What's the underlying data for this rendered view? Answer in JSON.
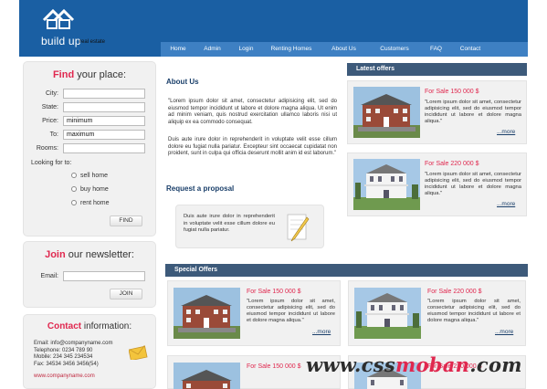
{
  "header": {
    "logo_text": "build up",
    "logo_sub": "real estate",
    "nav": [
      "Home",
      "Admin",
      "Login",
      "Renting Homes",
      "About Us",
      "Customers",
      "FAQ",
      "Contact"
    ]
  },
  "find": {
    "title_accent": "Find",
    "title_rest": " your place:",
    "fields": [
      {
        "label": "City:",
        "value": ""
      },
      {
        "label": "State:",
        "value": ""
      },
      {
        "label": "Price:",
        "value": "minimum"
      },
      {
        "label": "To:",
        "value": "maximum"
      },
      {
        "label": "Rooms:",
        "value": ""
      }
    ],
    "looking_label": "Looking for to:",
    "options": [
      "sell home",
      "buy home",
      "rent home"
    ],
    "button": "FIND"
  },
  "newsletter": {
    "title_accent": "Join",
    "title_rest": " our newsletter:",
    "email_label": "Email:",
    "email_value": "",
    "button": "JOIN"
  },
  "contact": {
    "title_accent": "Contact",
    "title_rest": " information:",
    "lines": [
      "Email: info@companyname.com",
      "Telephone: 0234 789 90",
      "Mobile: 234 345 234534",
      "Fax: 34534 3456 3456(54)"
    ],
    "site": "www.companyname.com"
  },
  "about": {
    "title": "About Us",
    "p1": "\"Lorem ipsum dolor sit amet, consectetur adipisicing elit, sed do eiusmod tempor incididunt ut labore et dolore magna aliqua. Ut enim ad minim veniam, quis nostrud exercitation ullamco laboris nisi ut aliquip ex ea commodo consequat.",
    "p2": "Duis aute irure dolor in reprehenderit in voluptate velit esse cillum dolore eu fugiat nulla pariatur. Excepteur sint occaecat cupidatat non proident, sunt in culpa qui officia deserunt mollit anim id est laborum.\""
  },
  "request": {
    "title": "Request a proposal",
    "text": "Duis aute irure dolor in reprehenderit in voluptate velit esse cillum dolore eu fugiat nulla pariatur."
  },
  "latest": {
    "title": "Latest offers",
    "items": [
      {
        "title": "For Sale 150 000 $",
        "desc": "\"Lorem ipsum dolor sit amet, consectetur adipisicing elit, sed do eiusmod tempor incididunt ut labore et dolore magna aliqua.\"",
        "more": "...more"
      },
      {
        "title": "For Sale 220 000 $",
        "desc": "\"Lorem ipsum dolor sit amet, consectetur adipisicing elit, sed do eiusmod tempor incididunt ut labore et dolore magna aliqua.\"",
        "more": "...more"
      }
    ]
  },
  "special": {
    "title": "Special Offers",
    "items": [
      {
        "title": "For Sale 150 000 $",
        "desc": "\"Lorem ipsum dolor sit amet, consectetur adipisicing elit, sed do eiusmod tempor incididunt ut labore et dolore magna aliqua.\"",
        "more": "...more"
      },
      {
        "title": "For Sale 220 000 $",
        "desc": "\"Lorem ipsum dolor sit amet, consectetur adipisicing elit, sed do eiusmod tempor incididunt ut labore et dolore magna aliqua.\"",
        "more": "...more"
      },
      {
        "title": "For Sale 150 000 $",
        "desc": "",
        "more": ""
      },
      {
        "title": "For Sale 220 000 $",
        "desc": "",
        "more": ""
      }
    ]
  },
  "watermark": {
    "pre": "www.css",
    "mid": "moban",
    "post": ".com"
  },
  "colors": {
    "header": "#1a5fa3",
    "nav": "#3e80c3",
    "accent": "#e0284f",
    "bar": "#3d5a7a",
    "heading": "#1a3f6a"
  }
}
